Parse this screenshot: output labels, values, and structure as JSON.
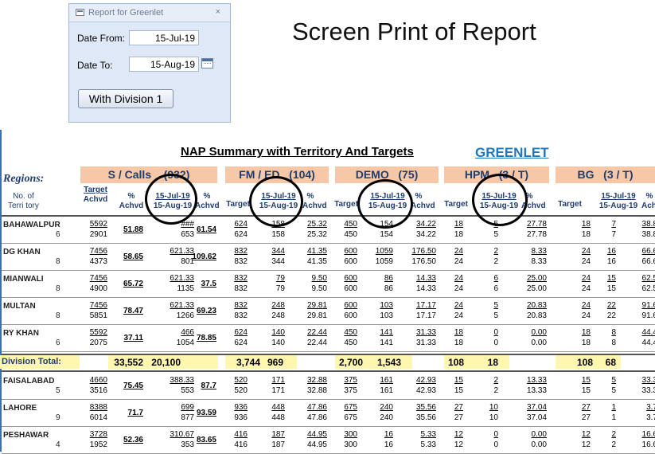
{
  "dialog": {
    "title": "Report for Greenlet",
    "date_from_label": "Date From:",
    "date_from_value": "15-Jul-19",
    "date_to_label": "Date To:",
    "date_to_value": "15-Aug-19",
    "button_label": "With Division 1"
  },
  "heading": "Screen Print of Report",
  "report": {
    "title": "NAP Summary with Territory And Targets",
    "brand": "GREENLET",
    "regions_label": "Regions:",
    "no_of_territory": [
      "No. of",
      "Terri tory"
    ],
    "groups": [
      {
        "name": "S / Calls",
        "count": "(932)"
      },
      {
        "name": "FM / ED",
        "count": "(104)"
      },
      {
        "name": "DEMO",
        "count": "(75)"
      },
      {
        "name": "HPM",
        "count": "(3 / T)"
      },
      {
        "name": "BG",
        "count": "(3 / T)"
      }
    ],
    "subheaders": {
      "target_achvd": [
        "Target",
        "Achvd"
      ],
      "pct_achvd": [
        "%",
        "Achvd"
      ],
      "date_range": [
        "15-Jul-19",
        "15-Aug-19"
      ],
      "target": "Target"
    },
    "rows": [
      {
        "name": "BAHAWALPUR",
        "terr": "6",
        "target": [
          "5592",
          "2901"
        ],
        "pct1": "51.88",
        "dr": [
          "###",
          "653"
        ],
        "pct2": "61.54",
        "fm": [
          "624",
          "624"
        ],
        "fm_dr": [
          "158",
          "158"
        ],
        "fm_pct": [
          "25.32",
          "25.32"
        ],
        "demo": [
          "450",
          "450"
        ],
        "demo_dr": [
          "154",
          "154"
        ],
        "demo_pct": [
          "34.22",
          "34.22"
        ],
        "hpm": [
          "18",
          "18"
        ],
        "hpm_dr": [
          "5",
          "5"
        ],
        "hpm_pct": [
          "27.78",
          "27.78"
        ],
        "bg": [
          "18",
          "18"
        ],
        "bg_dr": [
          "7",
          "7"
        ],
        "bg_pct": [
          "38.8",
          "38.8"
        ]
      },
      {
        "name": "DG KHAN",
        "terr": "8",
        "target": [
          "7456",
          "4373"
        ],
        "pct1": "58.65",
        "dr": [
          "621.33",
          "801"
        ],
        "pct2": "109.62",
        "fm": [
          "832",
          "832"
        ],
        "fm_dr": [
          "344",
          "344"
        ],
        "fm_pct": [
          "41.35",
          "41.35"
        ],
        "demo": [
          "600",
          "600"
        ],
        "demo_dr": [
          "1059",
          "1059"
        ],
        "demo_pct": [
          "176.50",
          "176.50"
        ],
        "hpm": [
          "24",
          "24"
        ],
        "hpm_dr": [
          "2",
          "2"
        ],
        "hpm_pct": [
          "8.33",
          "8.33"
        ],
        "bg": [
          "24",
          "24"
        ],
        "bg_dr": [
          "16",
          "16"
        ],
        "bg_pct": [
          "66.6",
          "66.6"
        ]
      },
      {
        "name": "MIANWALI",
        "terr": "8",
        "target": [
          "7456",
          "4900"
        ],
        "pct1": "65.72",
        "dr": [
          "621.33",
          "1135"
        ],
        "pct2": "37.5",
        "fm": [
          "832",
          "832"
        ],
        "fm_dr": [
          "79",
          "79"
        ],
        "fm_pct": [
          "9.50",
          "9.50"
        ],
        "demo": [
          "600",
          "600"
        ],
        "demo_dr": [
          "86",
          "86"
        ],
        "demo_pct": [
          "14.33",
          "14.33"
        ],
        "hpm": [
          "24",
          "24"
        ],
        "hpm_dr": [
          "6",
          "6"
        ],
        "hpm_pct": [
          "25.00",
          "25.00"
        ],
        "bg": [
          "24",
          "24"
        ],
        "bg_dr": [
          "15",
          "15"
        ],
        "bg_pct": [
          "62.5",
          "62.5"
        ]
      },
      {
        "name": "MULTAN",
        "terr": "8",
        "target": [
          "7456",
          "5851"
        ],
        "pct1": "78.47",
        "dr": [
          "621.33",
          "1266"
        ],
        "pct2": "69.23",
        "fm": [
          "832",
          "832"
        ],
        "fm_dr": [
          "248",
          "248"
        ],
        "fm_pct": [
          "29.81",
          "29.81"
        ],
        "demo": [
          "600",
          "600"
        ],
        "demo_dr": [
          "103",
          "103"
        ],
        "demo_pct": [
          "17.17",
          "17.17"
        ],
        "hpm": [
          "24",
          "24"
        ],
        "hpm_dr": [
          "5",
          "5"
        ],
        "hpm_pct": [
          "20.83",
          "20.83"
        ],
        "bg": [
          "24",
          "24"
        ],
        "bg_dr": [
          "22",
          "22"
        ],
        "bg_pct": [
          "91.6",
          "91.6"
        ]
      },
      {
        "name": "RY KHAN",
        "terr": "6",
        "target": [
          "5592",
          "2075"
        ],
        "pct1": "37.11",
        "dr": [
          "466",
          "1054"
        ],
        "pct2": "78.85",
        "fm": [
          "624",
          "624"
        ],
        "fm_dr": [
          "140",
          "140"
        ],
        "fm_pct": [
          "22.44",
          "22.44"
        ],
        "demo": [
          "450",
          "450"
        ],
        "demo_dr": [
          "141",
          "141"
        ],
        "demo_pct": [
          "31.33",
          "31.33"
        ],
        "hpm": [
          "18",
          "18"
        ],
        "hpm_dr": [
          "0",
          "0"
        ],
        "hpm_pct": [
          "0.00",
          "0.00"
        ],
        "bg": [
          "18",
          "18"
        ],
        "bg_dr": [
          "8",
          "8"
        ],
        "bg_pct": [
          "44.4",
          "44.4"
        ]
      }
    ],
    "division_total": {
      "label": "Division Total:",
      "calls_target": "33,552",
      "calls_dr": "20,100",
      "fm_target": "3,744",
      "fm_dr": "969",
      "demo_target": "2,700",
      "demo_dr": "1,543",
      "hpm_target": "108",
      "hpm_dr": "18",
      "bg_target": "108",
      "bg_dr": "68"
    },
    "rows2": [
      {
        "name": "FAISALABAD",
        "terr": "5",
        "target": [
          "4660",
          "3516"
        ],
        "pct1": "75.45",
        "dr": [
          "388.33",
          "553"
        ],
        "pct2": "87.7",
        "fm": [
          "520",
          "520"
        ],
        "fm_dr": [
          "171",
          "171"
        ],
        "fm_pct": [
          "32.88",
          "32.88"
        ],
        "demo": [
          "375",
          "375"
        ],
        "demo_dr": [
          "161",
          "161"
        ],
        "demo_pct": [
          "42.93",
          "42.93"
        ],
        "hpm": [
          "15",
          "15"
        ],
        "hpm_dr": [
          "2",
          "2"
        ],
        "hpm_pct": [
          "13.33",
          "13.33"
        ],
        "bg": [
          "15",
          "15"
        ],
        "bg_dr": [
          "5",
          "5"
        ],
        "bg_pct": [
          "33.3",
          "33.3"
        ]
      },
      {
        "name": "LAHORE",
        "terr": "9",
        "target": [
          "8388",
          "6014"
        ],
        "pct1": "71.7",
        "dr": [
          "699",
          "877"
        ],
        "pct2": "93.59",
        "fm": [
          "936",
          "936"
        ],
        "fm_dr": [
          "448",
          "448"
        ],
        "fm_pct": [
          "47.86",
          "47.86"
        ],
        "demo": [
          "675",
          "675"
        ],
        "demo_dr": [
          "240",
          "240"
        ],
        "demo_pct": [
          "35.56",
          "35.56"
        ],
        "hpm": [
          "27",
          "27"
        ],
        "hpm_dr": [
          "10",
          "10"
        ],
        "hpm_pct": [
          "37.04",
          "37.04"
        ],
        "bg": [
          "27",
          "27"
        ],
        "bg_dr": [
          "1",
          "1"
        ],
        "bg_pct": [
          "3.7",
          "3.7"
        ]
      },
      {
        "name": "PESHAWAR",
        "terr": "4",
        "target": [
          "3728",
          "1952"
        ],
        "pct1": "52.36",
        "dr": [
          "310.67",
          "353"
        ],
        "pct2": "83.65",
        "fm": [
          "416",
          "416"
        ],
        "fm_dr": [
          "187",
          "187"
        ],
        "fm_pct": [
          "44.95",
          "44.95"
        ],
        "demo": [
          "300",
          "300"
        ],
        "demo_dr": [
          "16",
          "16"
        ],
        "demo_pct": [
          "5.33",
          "5.33"
        ],
        "hpm": [
          "12",
          "12"
        ],
        "hpm_dr": [
          "0",
          "0"
        ],
        "hpm_pct": [
          "0.00",
          "0.00"
        ],
        "bg": [
          "12",
          "12"
        ],
        "bg_dr": [
          "2",
          "2"
        ],
        "bg_pct": [
          "16.6",
          "16.6"
        ]
      }
    ]
  }
}
